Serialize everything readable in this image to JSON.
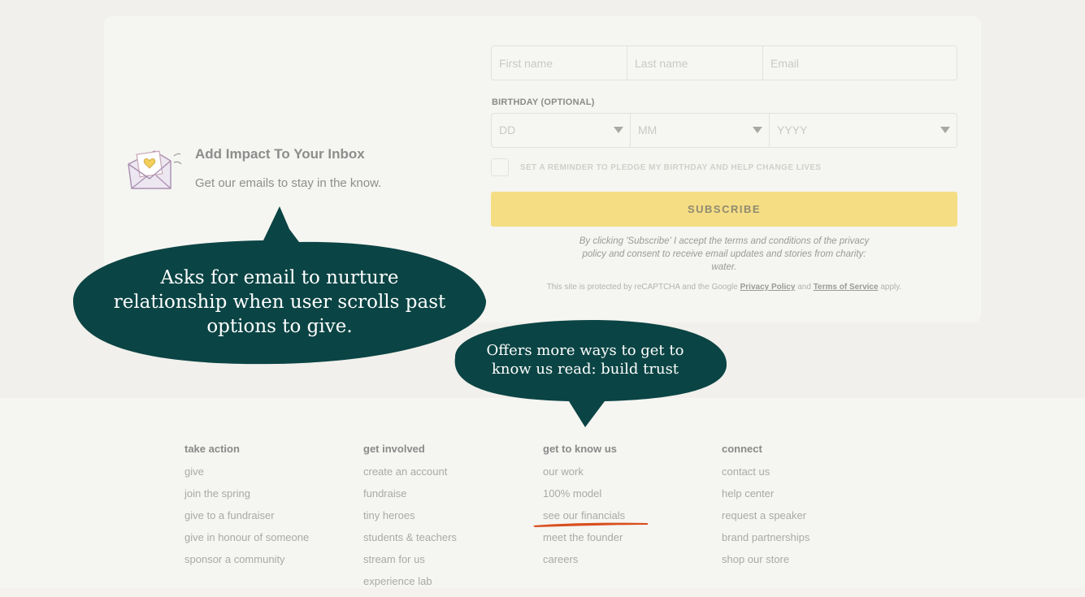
{
  "promo": {
    "title": "Add Impact To Your Inbox",
    "subtitle": "Get our emails to stay in the know."
  },
  "form": {
    "first_name_placeholder": "First name",
    "last_name_placeholder": "Last name",
    "email_placeholder": "Email",
    "birthday_label": "BIRTHDAY (OPTIONAL)",
    "day_value": "DD",
    "month_value": "MM",
    "year_value": "YYYY",
    "reminder_label": "SET A REMINDER TO PLEDGE MY BIRTHDAY AND HELP CHANGE LIVES",
    "subscribe_label": "SUBSCRIBE",
    "terms_text": "By clicking 'Subscribe' I accept the terms and conditions of the privacy policy and consent to receive email updates and stories from charity: water.",
    "recaptcha_prefix": "This site is protected by reCAPTCHA and the Google",
    "privacy_link": "Privacy Policy",
    "recaptcha_and": "and",
    "tos_link": "Terms of Service",
    "recaptcha_suffix": "apply."
  },
  "annotations": {
    "email_callout": "Asks for email to nurture relationship when user scrolls past options to give.",
    "trust_callout": "Offers more ways to get to know us read: build trust",
    "highlight_color": "#d94f1e",
    "callout_color": "#0b4444"
  },
  "footer": {
    "columns": [
      {
        "heading": "take action",
        "links": [
          "give",
          "join the spring",
          "give to a fundraiser",
          "give in honour of someone",
          "sponsor a community"
        ]
      },
      {
        "heading": "get involved",
        "links": [
          "create an account",
          "fundraise",
          "tiny heroes",
          "students & teachers",
          "stream for us",
          "experience lab"
        ]
      },
      {
        "heading": "get to know us",
        "links": [
          "our work",
          "100% model",
          "see our financials",
          "meet the founder",
          "careers"
        ]
      },
      {
        "heading": "connect",
        "links": [
          "contact us",
          "help center",
          "request a speaker",
          "brand partnerships",
          "shop our store"
        ]
      }
    ]
  }
}
